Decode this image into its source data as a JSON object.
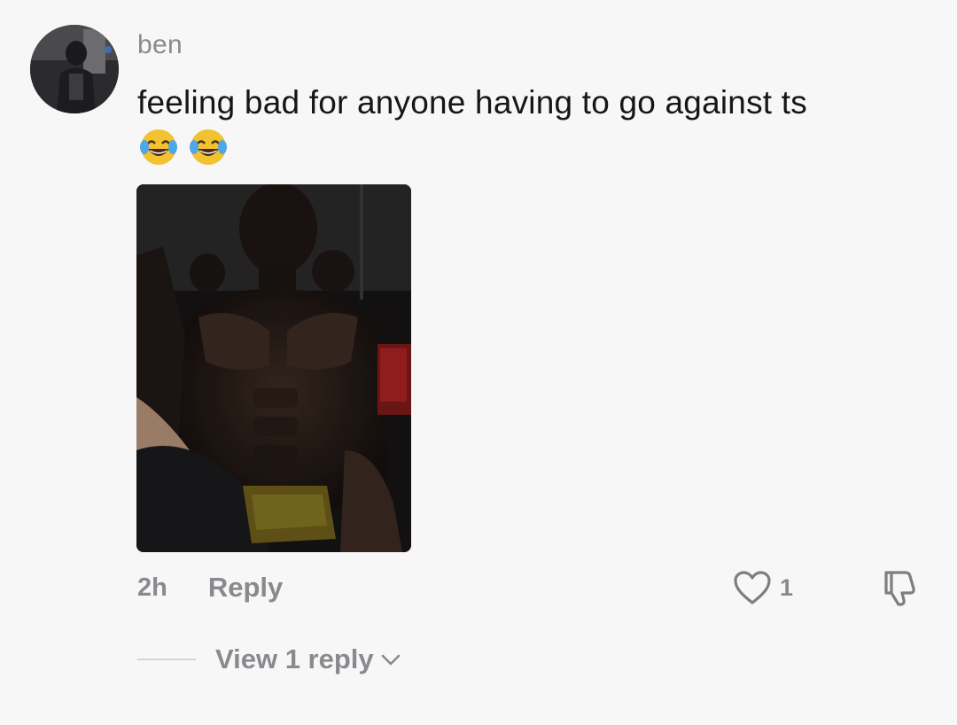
{
  "comment": {
    "username": "ben",
    "text": "feeling bad for anyone having to go against ts",
    "emojis": [
      "face-with-tears-of-joy-emoji",
      "face-with-tears-of-joy-emoji"
    ],
    "timestamp": "2h",
    "reply_label": "Reply",
    "like_count": "1",
    "view_replies_label": "View 1 reply"
  },
  "icons": {
    "like": "heart-icon",
    "dislike": "thumbs-down-icon",
    "expand": "chevron-down-icon"
  },
  "colors": {
    "background": "#f8f7f8",
    "text_primary": "#161616",
    "text_secondary": "#8a8a8e"
  }
}
